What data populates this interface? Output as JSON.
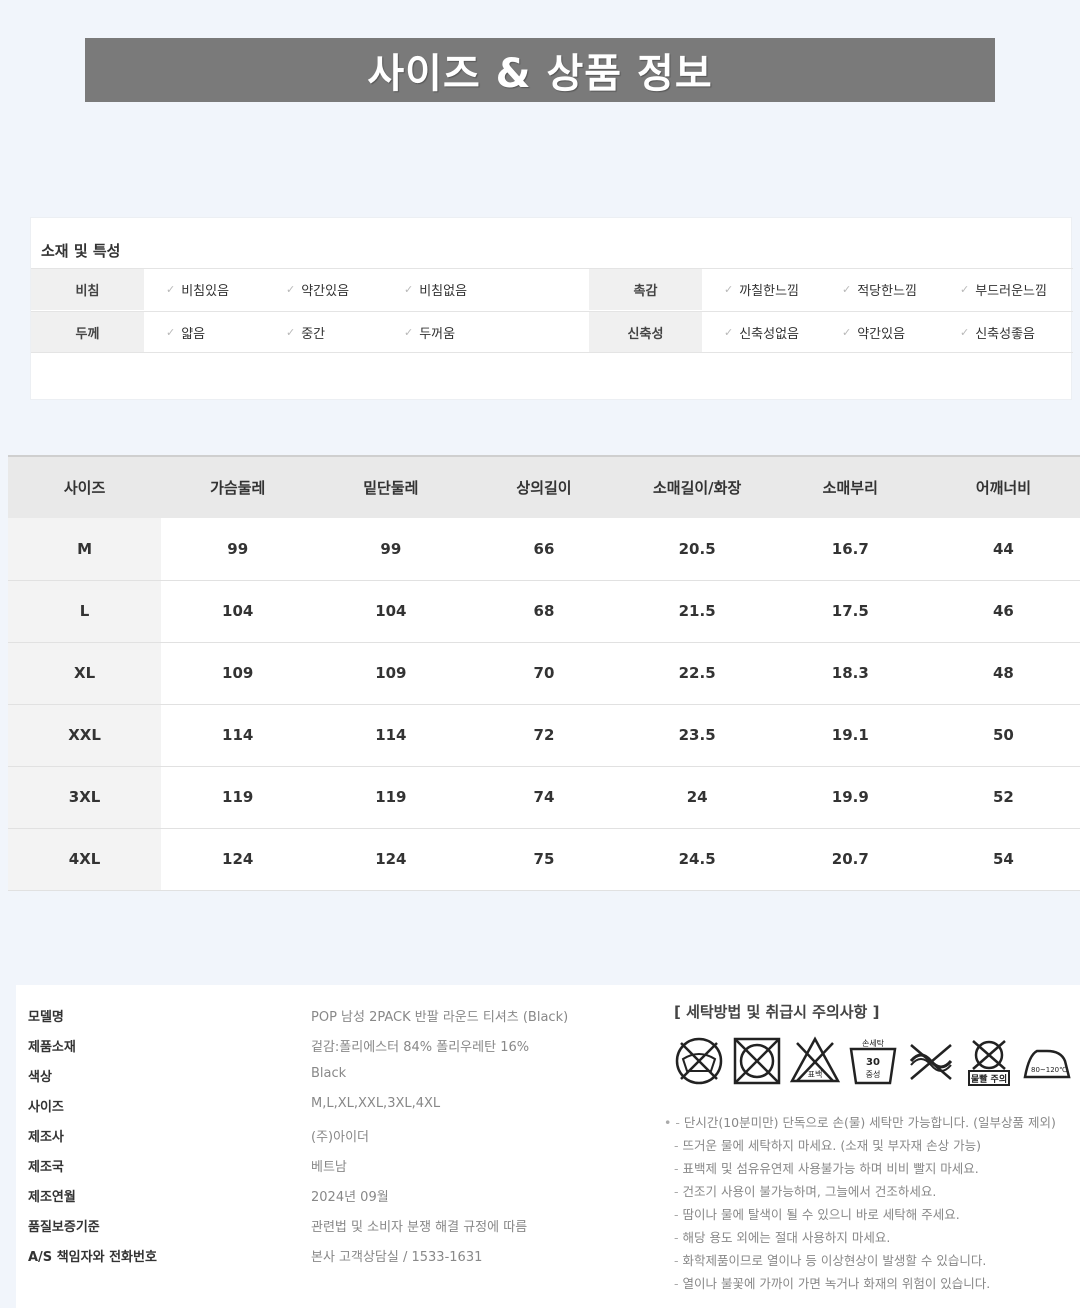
{
  "title": "사이즈 & 상품 정보",
  "material": {
    "title": "소재 및 특성",
    "rows": [
      {
        "label1": "비침",
        "opts1": [
          "비침있음",
          "약간있음",
          "비침없음"
        ],
        "label2": "촉감",
        "opts2": [
          "까칠한느낌",
          "적당한느낌",
          "부드러운느낌"
        ]
      },
      {
        "label1": "두께",
        "opts1": [
          "얇음",
          "중간",
          "두꺼움"
        ],
        "label2": "신축성",
        "opts2": [
          "신축성없음",
          "약간있음",
          "신축성좋음"
        ]
      }
    ],
    "check": "✓"
  },
  "size_table": {
    "headers": [
      "사이즈",
      "가슴둘레",
      "밑단둘레",
      "상의길이",
      "소매길이/화장",
      "소매부리",
      "어깨너비"
    ],
    "rows": [
      [
        "M",
        "99",
        "99",
        "66",
        "20.5",
        "16.7",
        "44"
      ],
      [
        "L",
        "104",
        "104",
        "68",
        "21.5",
        "17.5",
        "46"
      ],
      [
        "XL",
        "109",
        "109",
        "70",
        "22.5",
        "18.3",
        "48"
      ],
      [
        "XXL",
        "114",
        "114",
        "72",
        "23.5",
        "19.1",
        "50"
      ],
      [
        "3XL",
        "119",
        "119",
        "74",
        "24",
        "19.9",
        "52"
      ],
      [
        "4XL",
        "124",
        "124",
        "75",
        "24.5",
        "20.7",
        "54"
      ]
    ]
  },
  "product_info": [
    {
      "k": "모델명",
      "v": "POP 남성 2PACK 반팔 라운드 티셔츠 (Black)"
    },
    {
      "k": "제품소재",
      "v": "겉감:폴리에스터 84% 폴리우레탄 16%"
    },
    {
      "k": "색상",
      "v": "Black"
    },
    {
      "k": "사이즈",
      "v": "M,L,XL,XXL,3XL,4XL"
    },
    {
      "k": "제조사",
      "v": "(주)아이더"
    },
    {
      "k": "제조국",
      "v": "베트남"
    },
    {
      "k": "제조연월",
      "v": "2024년 09월"
    },
    {
      "k": "품질보증기준",
      "v": "관련법 및 소비자 분쟁 해결 규정에 따름"
    },
    {
      "k": "A/S 책임자와 전화번호",
      "v": "본사 고객상담실 / 1533-1631"
    }
  ],
  "washing": {
    "title": "[ 세탁방법 및 취급시 주의사항 ]",
    "icons": [
      "hand-wash-icon",
      "no-tumble-dry-icon",
      "no-bleach-icon",
      "dry-clean-icon",
      "no-wring-icon",
      "no-dry-clean-icon",
      "iron-low-icon"
    ],
    "icon_labels": [
      "손세탁",
      "표백",
      "손세탁 30 중성세제",
      "물빨 주의",
      "80~120℃"
    ],
    "notes": [
      "단시간(10분미만) 단독으로 손(물) 세탁만 가능합니다. (일부상품 제외)",
      "뜨거운 물에 세탁하지 마세요. (소재 및 부자재 손상 가능)",
      "표백제 및 섬유유연제 사용불가능 하며 비비 빨지 마세요.",
      "건조기 사용이 불가능하며, 그늘에서 건조하세요.",
      "땀이나 물에 탈색이 될 수 있으니 바로 세탁해 주세요.",
      "해당 용도 외에는 절대 사용하지 마세요.",
      "화학제품이므로 열이나 등 이상현상이 발생할 수 있습니다.",
      "열이나 불꽃에 가까이 가면 녹거나 화재의 위험이 있습니다."
    ]
  }
}
